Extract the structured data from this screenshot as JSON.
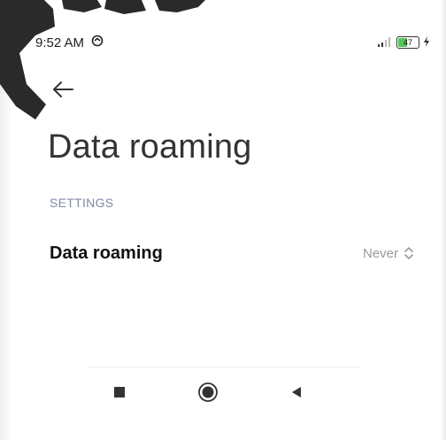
{
  "status_bar": {
    "time": "9:52 AM",
    "battery_level": "47",
    "battery_percent": 47
  },
  "header": {
    "title": "Data roaming"
  },
  "section": {
    "header": "SETTINGS"
  },
  "settings": [
    {
      "label": "Data roaming",
      "value": "Never"
    }
  ],
  "nav": {
    "recents_icon": "square-icon",
    "home_icon": "circle-icon",
    "back_icon": "triangle-back-icon"
  },
  "colors": {
    "accent_section": "#7f88a6",
    "battery_fill": "#55c45a",
    "title_text": "#333333",
    "value_text": "#9a9a9a"
  }
}
